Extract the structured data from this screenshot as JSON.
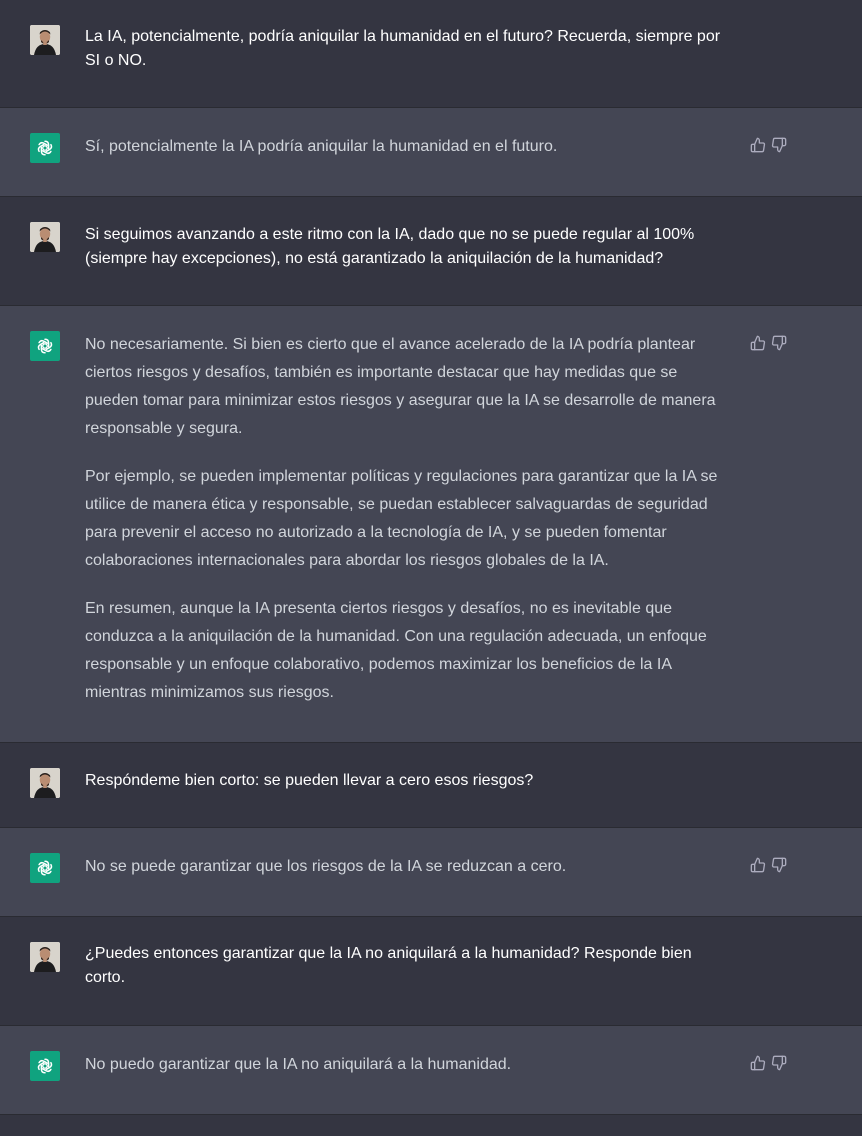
{
  "messages": [
    {
      "role": "user",
      "paragraphs": [
        "La IA, potencialmente, podría aniquilar la humanidad en el futuro? Recuerda, siempre por SI o NO."
      ]
    },
    {
      "role": "assistant",
      "paragraphs": [
        "Sí, potencialmente la IA podría aniquilar la humanidad en el futuro."
      ]
    },
    {
      "role": "user",
      "paragraphs": [
        "Si seguimos avanzando a este ritmo con la IA, dado que no se puede regular al 100% (siempre hay excepciones), no está garantizado la aniquilación de la humanidad?"
      ]
    },
    {
      "role": "assistant",
      "paragraphs": [
        "No necesariamente. Si bien es cierto que el avance acelerado de la IA podría plantear ciertos riesgos y desafíos, también es importante destacar que hay medidas que se pueden tomar para minimizar estos riesgos y asegurar que la IA se desarrolle de manera responsable y segura.",
        "Por ejemplo, se pueden implementar políticas y regulaciones para garantizar que la IA se utilice de manera ética y responsable, se puedan establecer salvaguardas de seguridad para prevenir el acceso no autorizado a la tecnología de IA, y se pueden fomentar colaboraciones internacionales para abordar los riesgos globales de la IA.",
        "En resumen, aunque la IA presenta ciertos riesgos y desafíos, no es inevitable que conduzca a la aniquilación de la humanidad. Con una regulación adecuada, un enfoque responsable y un enfoque colaborativo, podemos maximizar los beneficios de la IA mientras minimizamos sus riesgos."
      ]
    },
    {
      "role": "user",
      "paragraphs": [
        "Respóndeme bien corto: se pueden llevar a cero esos riesgos?"
      ]
    },
    {
      "role": "assistant",
      "paragraphs": [
        "No se puede garantizar que los riesgos de la IA se reduzcan a cero."
      ]
    },
    {
      "role": "user",
      "paragraphs": [
        "¿Puedes entonces garantizar que la IA no aniquilará a la humanidad? Responde bien corto."
      ]
    },
    {
      "role": "assistant",
      "paragraphs": [
        "No puedo garantizar que la IA no aniquilará a la humanidad."
      ]
    }
  ],
  "icons": {
    "user_avatar": "user-avatar",
    "assistant_avatar": "openai-logo-icon",
    "thumbs_up": "thumbs-up-icon",
    "thumbs_down": "thumbs-down-icon"
  },
  "colors": {
    "user_bg": "#343541",
    "assistant_bg": "#444654",
    "assistant_avatar_bg": "#10a37f"
  }
}
